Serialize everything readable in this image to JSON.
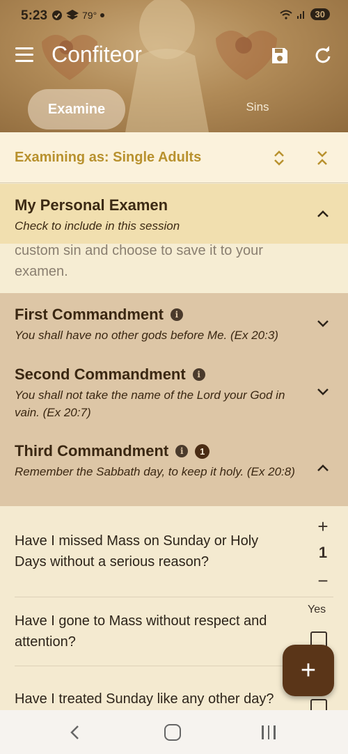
{
  "status": {
    "time": "5:23",
    "temp": "79°",
    "battery": "30"
  },
  "app": {
    "title": "Confiteor"
  },
  "tabs": [
    {
      "label": "Examine",
      "active": true
    },
    {
      "label": "Sins",
      "active": false
    }
  ],
  "examining": {
    "label": "Examining as: Single Adults"
  },
  "personal": {
    "title": "My Personal Examen",
    "subtitle": "Check to include in this session",
    "body_text": "custom sin and choose to save it to your examen."
  },
  "commandments": [
    {
      "title": "First Commandment",
      "subtitle": "You shall have no other gods before Me. (Ex 20:3)",
      "expanded": false
    },
    {
      "title": "Second Commandment",
      "subtitle": "You shall not take the name of the Lord your God in vain. (Ex 20:7)",
      "expanded": false
    },
    {
      "title": "Third Commandment",
      "subtitle": "Remember the Sabbath day, to keep it holy. (Ex 20:8)",
      "count": "1",
      "expanded": true
    }
  ],
  "questions": [
    {
      "text": "Have I missed Mass on Sunday or Holy Days without a serious reason?",
      "type": "stepper",
      "count": "1"
    },
    {
      "text": "Have I gone to Mass without respect and attention?",
      "type": "checkbox",
      "checked": false
    },
    {
      "text": "Have I treated Sunday like any other day?",
      "type": "checkbox",
      "checked": false
    }
  ],
  "checkbox_header": "Yes",
  "stepper": {
    "plus": "+",
    "minus": "−"
  },
  "fab": {
    "label": "+"
  },
  "colors": {
    "accent": "#b8912e",
    "fab": "#5a3518",
    "section_bg": "#ddc6a6",
    "personal_bg": "#f1dfaf"
  }
}
